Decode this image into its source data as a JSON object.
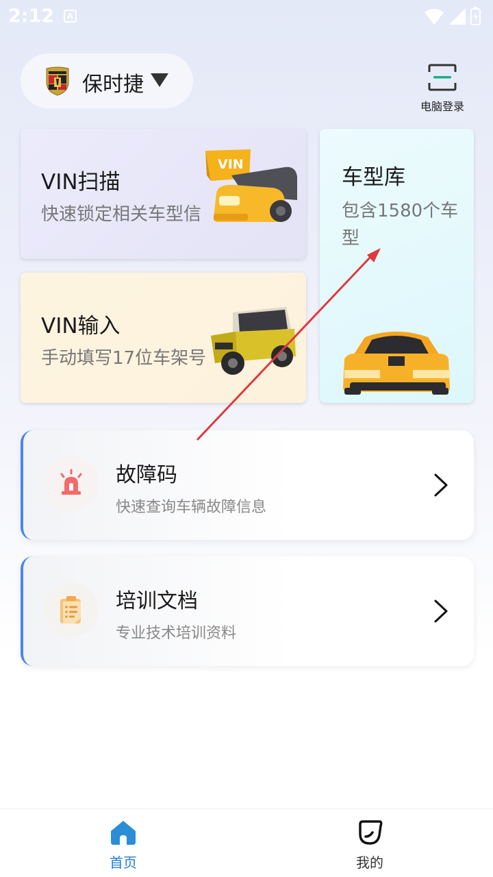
{
  "status_bar": {
    "time": "2:12",
    "notification_icon": "a-icon",
    "icons": [
      "wifi-icon",
      "signal-icon",
      "battery-icon"
    ]
  },
  "header": {
    "brand_name": "保时捷",
    "brand_logo": "porsche-logo",
    "pc_login_label": "电脑登录",
    "pc_login_icon": "scan-icon"
  },
  "cards": {
    "vin_scan": {
      "title": "VIN扫描",
      "subtitle": "快速锁定相关车型信",
      "badge": "VIN"
    },
    "vin_input": {
      "title": "VIN输入",
      "subtitle": "手动填写17位车架号"
    },
    "model_library": {
      "title": "车型库",
      "subtitle": "包含1580个车型"
    }
  },
  "list": [
    {
      "title": "故障码",
      "subtitle": "快速查询车辆故障信息",
      "icon": "alarm-siren-icon"
    },
    {
      "title": "培训文档",
      "subtitle": "专业技术培训资料",
      "icon": "document-icon"
    }
  ],
  "bottom_nav": {
    "home_label": "首页",
    "mine_label": "我的"
  },
  "colors": {
    "accent": "#1e7fd0",
    "list_border": "#4a86e8",
    "annotation_arrow": "#e0383e"
  }
}
